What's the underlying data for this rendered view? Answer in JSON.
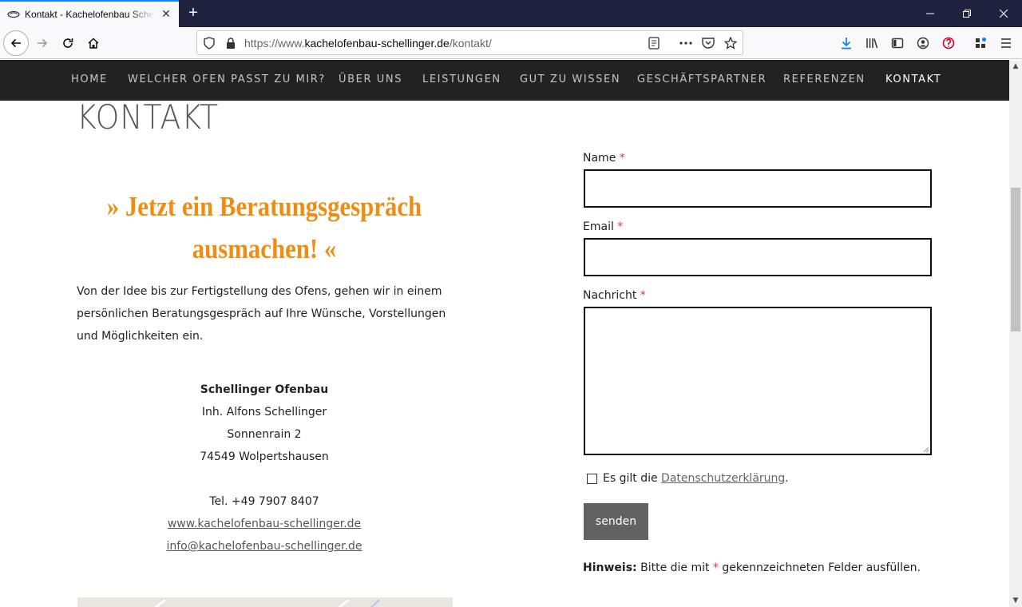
{
  "browser": {
    "tab_title": "Kontakt - Kachelofenbau Schellinger",
    "url_prefix": "https://www.",
    "url_domain": "kachelofenbau-schellinger.de",
    "url_path": "/kontakt/",
    "accent": "#0a84ff"
  },
  "menu": {
    "items": [
      "HOME",
      "WELCHER OFEN PASST ZU MIR?",
      "ÜBER UNS",
      "LEISTUNGEN",
      "GUT ZU WISSEN",
      "GESCHÄFTSPARTNER",
      "REFERENZEN",
      "KONTAKT"
    ],
    "active": "KONTAKT"
  },
  "page": {
    "title": "KONTAKT",
    "heading_line1": "» Jetzt ein Beratungsgespräch",
    "heading_line2": "ausmachen! «",
    "intro": "Von der Idee bis zur Fertigstellung des Ofens, gehen wir in einem persönlichen Beratungsgespräch auf Ihre Wünsche, Vorstellungen und Möglichkeiten ein.",
    "company": "Schellinger Ofenbau",
    "owner": "Inh. Alfons Schellinger",
    "street": "Sonnenrain 2",
    "city": "74549 Wolpertshausen",
    "phone": "Tel. +49 7907 8407",
    "website": "www.kachelofenbau-schellinger.de",
    "email": "info@kachelofenbau-schellinger.de",
    "heading_color": "#ee8d12"
  },
  "form": {
    "name_label": "Name",
    "email_label": "Email",
    "message_label": "Nachricht",
    "required_mark": "*",
    "privacy_prefix": "Es gilt die",
    "privacy_link": "Datenschutzerklärung",
    "privacy_suffix": ".",
    "submit": "senden",
    "hint_bold": "Hinweis:",
    "hint_text_1": "Bitte die mit",
    "hint_text_2": "gekennzeichneten Felder ausfüllen."
  }
}
